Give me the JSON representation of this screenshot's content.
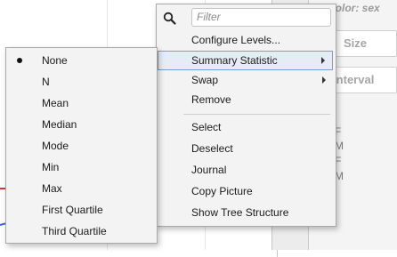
{
  "background_panel": {
    "color_label": "Color: sex",
    "buttons": [
      "Size",
      "nterval"
    ],
    "legend": [
      "F",
      "M",
      "F",
      "M"
    ]
  },
  "main_menu": {
    "filter_placeholder": "Filter",
    "items": [
      {
        "label": "Configure Levels..."
      },
      {
        "label": "Summary Statistic",
        "submenu": true,
        "highlighted": true
      },
      {
        "label": "Swap",
        "submenu": true
      },
      {
        "label": "Remove"
      },
      {
        "label": "Select"
      },
      {
        "label": "Deselect"
      },
      {
        "label": "Journal"
      },
      {
        "label": "Copy Picture"
      },
      {
        "label": "Show Tree Structure"
      }
    ]
  },
  "submenu": {
    "selected": "None",
    "items": [
      "None",
      "N",
      "Mean",
      "Median",
      "Mode",
      "Min",
      "Max",
      "First Quartile",
      "Third Quartile"
    ]
  },
  "colors": {
    "highlight_bg": "#e6ecf6",
    "highlight_border": "#7a9ccf",
    "menu_bg": "#f3f3f3"
  }
}
